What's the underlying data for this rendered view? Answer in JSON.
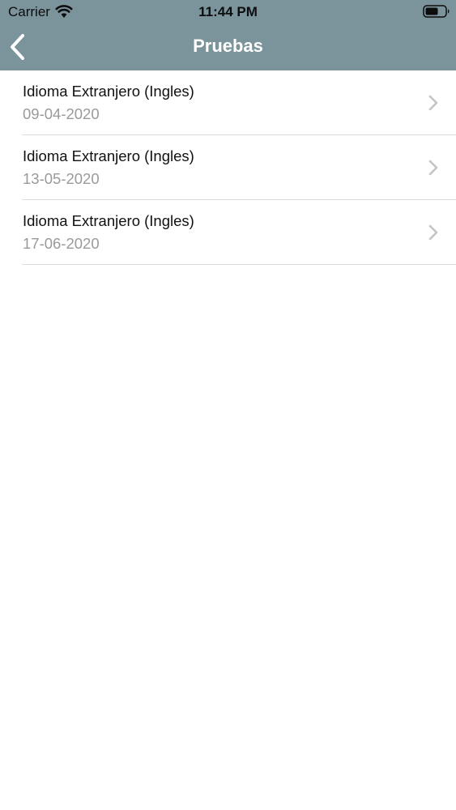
{
  "status_bar": {
    "carrier": "Carrier",
    "time": "11:44 PM",
    "wifi_icon": "wifi-icon",
    "battery_icon": "battery-icon"
  },
  "nav": {
    "title": "Pruebas",
    "back_icon": "chevron-left-icon",
    "bar_color": "#7b949c"
  },
  "tests": [
    {
      "name": "Idioma Extranjero (Ingles)",
      "date": "09-04-2020"
    },
    {
      "name": "Idioma Extranjero (Ingles)",
      "date": "13-05-2020"
    },
    {
      "name": "Idioma Extranjero (Ingles)",
      "date": "17-06-2020"
    }
  ],
  "row_icon": "chevron-right-icon"
}
